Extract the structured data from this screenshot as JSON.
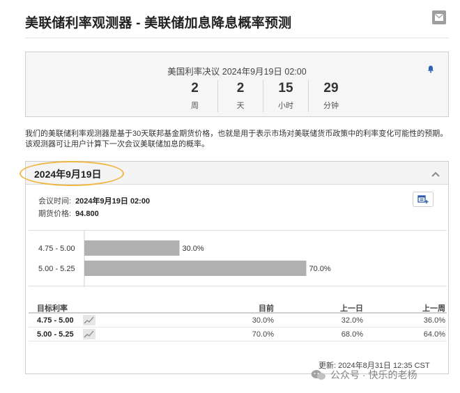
{
  "header": {
    "title": "美联储利率观测器 - 美联储加息降息概率预测",
    "icons": {
      "mail": "mail-icon"
    }
  },
  "countdown": {
    "label": "美国利率决议 2024年9月19日 02:00",
    "units": [
      {
        "value": "2",
        "name": "周"
      },
      {
        "value": "2",
        "name": "天"
      },
      {
        "value": "15",
        "name": "小时"
      },
      {
        "value": "29",
        "name": "分钟"
      }
    ],
    "icons": {
      "bell": "bell-icon"
    }
  },
  "description": "我们的美联储利率观测器是基于30天联邦基金期货价格，也就是用于表示市场对美联储货币政策中的利率变化可能性的预期。该观测器可让用户计算下一次会议美联储加息的概率。",
  "panel": {
    "date": "2024年9月19日",
    "meeting_time_label": "会议时间:",
    "meeting_time": "2024年9月19日 02:00",
    "futures_price_label": "期货价格:",
    "futures_price": "94.800",
    "highlight_color": "#f0b642",
    "icons": {
      "collapse": "chevron-up-icon",
      "calendar": "calendar-add-icon"
    }
  },
  "chart_data": {
    "type": "bar",
    "orientation": "horizontal",
    "categories": [
      "4.75 - 5.00",
      "5.00 - 5.25"
    ],
    "values": [
      30.0,
      70.0
    ],
    "value_labels": [
      "30.0%",
      "70.0%"
    ],
    "xlim": [
      0,
      100
    ],
    "bar_color": "#b0b0b0"
  },
  "table": {
    "headers": [
      "目标利率",
      "目前",
      "上一日",
      "上一周"
    ],
    "rows": [
      {
        "rate": "4.75 - 5.00",
        "current": "30.0%",
        "prev_day": "32.0%",
        "prev_week": "36.0%"
      },
      {
        "rate": "5.00 - 5.25",
        "current": "70.0%",
        "prev_day": "68.0%",
        "prev_week": "64.0%"
      }
    ]
  },
  "updated": "更新: 2024年8月31日 12:35 CST",
  "watermark": "公众号 · 快乐的老杨"
}
